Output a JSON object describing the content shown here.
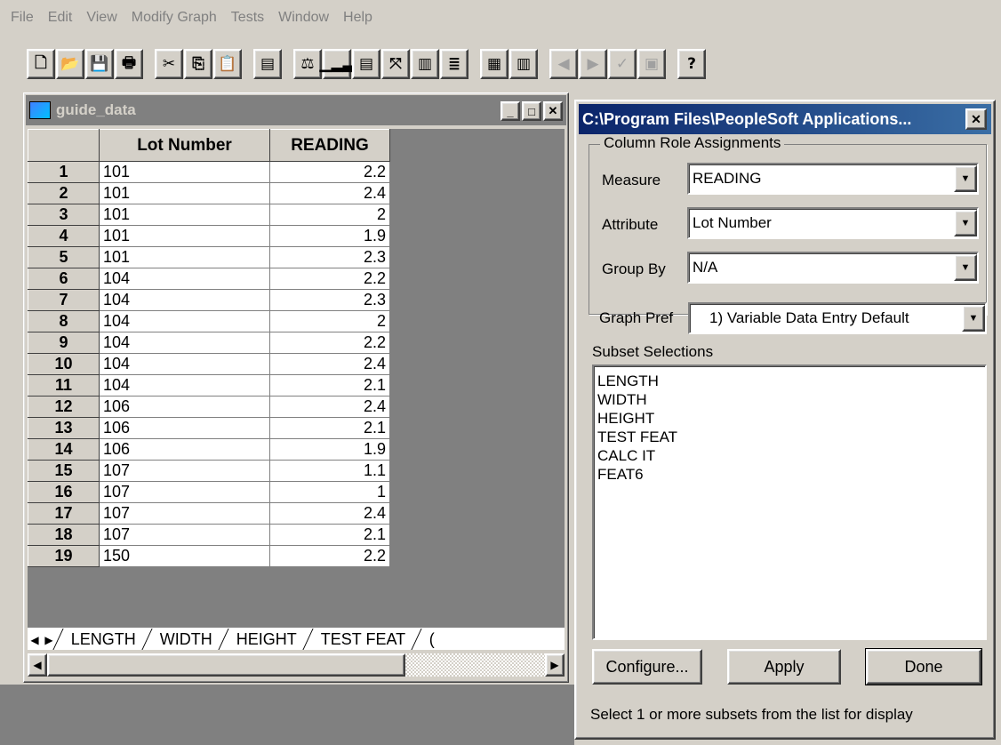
{
  "menu": [
    "File",
    "Edit",
    "View",
    "Modify Graph",
    "Tests",
    "Window",
    "Help"
  ],
  "toolbar": {
    "icons": [
      "new-icon",
      "open-icon",
      "save-icon",
      "print-icon",
      "cut-icon",
      "copy-icon",
      "paste-icon",
      "notes-icon",
      "control-chart-icon",
      "histogram-icon",
      "pareto-icon",
      "scatter-icon",
      "box-icon",
      "normal-icon",
      "grid-icon",
      "table-icon",
      "prev-icon",
      "next-icon",
      "check-icon",
      "layout-icon",
      "help-icon"
    ],
    "glyphs": [
      "🗋",
      "📂",
      "💾",
      "🖶",
      "✂",
      "⎘",
      "📋",
      "▤",
      "⚖",
      "▁▂▃",
      "▤",
      "⤧",
      "▥",
      "≣",
      "▦",
      "▥",
      "◀",
      "▶",
      "✓",
      "▣",
      "?"
    ]
  },
  "dataWindow": {
    "title": "guide_data",
    "columns": [
      "Lot Number",
      "READING"
    ],
    "rows": [
      [
        "1",
        "101",
        "2.2"
      ],
      [
        "2",
        "101",
        "2.4"
      ],
      [
        "3",
        "101",
        "2"
      ],
      [
        "4",
        "101",
        "1.9"
      ],
      [
        "5",
        "101",
        "2.3"
      ],
      [
        "6",
        "104",
        "2.2"
      ],
      [
        "7",
        "104",
        "2.3"
      ],
      [
        "8",
        "104",
        "2"
      ],
      [
        "9",
        "104",
        "2.2"
      ],
      [
        "10",
        "104",
        "2.4"
      ],
      [
        "11",
        "104",
        "2.1"
      ],
      [
        "12",
        "106",
        "2.4"
      ],
      [
        "13",
        "106",
        "2.1"
      ],
      [
        "14",
        "106",
        "1.9"
      ],
      [
        "15",
        "107",
        "1.1"
      ],
      [
        "16",
        "107",
        "1"
      ],
      [
        "17",
        "107",
        "2.4"
      ],
      [
        "18",
        "107",
        "2.1"
      ],
      [
        "19",
        "150",
        "2.2"
      ]
    ],
    "sheetTabs": [
      "LENGTH",
      "WIDTH",
      "HEIGHT",
      "TEST FEAT",
      "("
    ]
  },
  "dialog": {
    "title": "C:\\Program Files\\PeopleSoft Applications...",
    "groupLabel": "Column Role Assignments",
    "measureLabel": "Measure",
    "measureValue": "READING",
    "attributeLabel": "Attribute",
    "attributeValue": "Lot Number",
    "groupByLabel": "Group By",
    "groupByValue": "N/A",
    "graphPrefLabel": "Graph Pref",
    "graphPrefValue": "1) Variable Data Entry Default",
    "subsetLabel": "Subset Selections",
    "subsets": [
      "LENGTH",
      "WIDTH",
      "HEIGHT",
      "TEST FEAT",
      "CALC IT",
      "FEAT6"
    ],
    "configureLabel": "Configure...",
    "applyLabel": "Apply",
    "doneLabel": "Done",
    "status": "Select 1 or more subsets from the list for display"
  }
}
